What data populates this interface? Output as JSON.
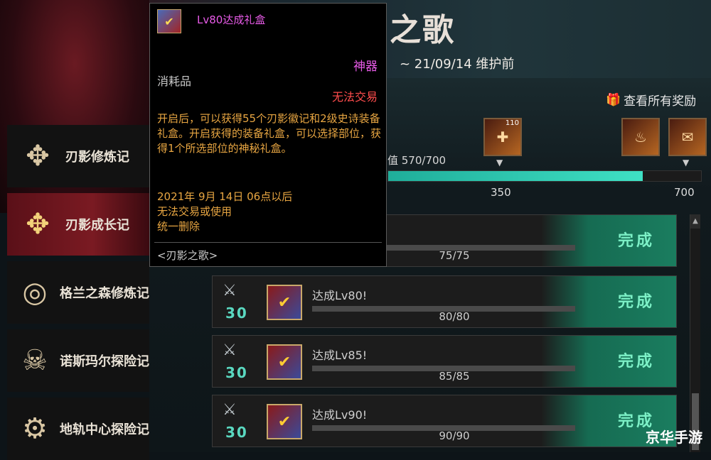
{
  "banner": {
    "title": "之歌",
    "date": "~ 21/09/14 维护前"
  },
  "sidebar": {
    "items": [
      {
        "label": "刃影修炼记",
        "icon": "compass-emblem-icon",
        "active": false
      },
      {
        "label": "刃影成长记",
        "icon": "compass-emblem-icon",
        "active": true
      },
      {
        "label": "格兰之森修炼记",
        "icon": "spiral-portal-icon",
        "active": false
      },
      {
        "label": "诺斯玛尔探险记",
        "icon": "skull-gate-icon",
        "active": false
      },
      {
        "label": "地轨中心探险记",
        "icon": "gear-machine-icon",
        "active": false
      }
    ]
  },
  "rewards": {
    "view_all": "查看所有奖励",
    "progress_label": "值 570/700",
    "progress": {
      "current": 570,
      "max": 700
    },
    "ticks": [
      "350",
      "700"
    ],
    "items": [
      {
        "icon": "gift-box-icon",
        "count": "110"
      },
      {
        "icon": "potion-icon",
        "count": ""
      },
      {
        "icon": "scroll-box-icon",
        "count": ""
      }
    ]
  },
  "quests": [
    {
      "points": "",
      "title": "",
      "count": "75/75",
      "status": "完成"
    },
    {
      "points": "30",
      "title": "达成Lv80!",
      "count": "80/80",
      "status": "完成"
    },
    {
      "points": "30",
      "title": "达成Lv85!",
      "count": "85/85",
      "status": "完成"
    },
    {
      "points": "30",
      "title": "达成Lv90!",
      "count": "90/90",
      "status": "完成"
    }
  ],
  "tooltip": {
    "name": "Lv80达成礼盒",
    "rarity": "神器",
    "type": "消耗品",
    "trade": "无法交易",
    "desc": "开启后，可以获得55个刃影徽记和2级史诗装备礼盒。开启获得的装备礼盒，可以选择部位，获得1个所选部位的神秘礼盒。",
    "expire_1": "2021年 9月 14日 06点以后",
    "expire_2": "无法交易或使用",
    "expire_3": "统一删除",
    "set": "<刃影之歌>"
  },
  "watermark": "京华手游",
  "colors": {
    "accent": "#3fe0c4",
    "rarity": "#e85be8",
    "warning": "#ff4d4d",
    "desc": "#e8a642"
  }
}
